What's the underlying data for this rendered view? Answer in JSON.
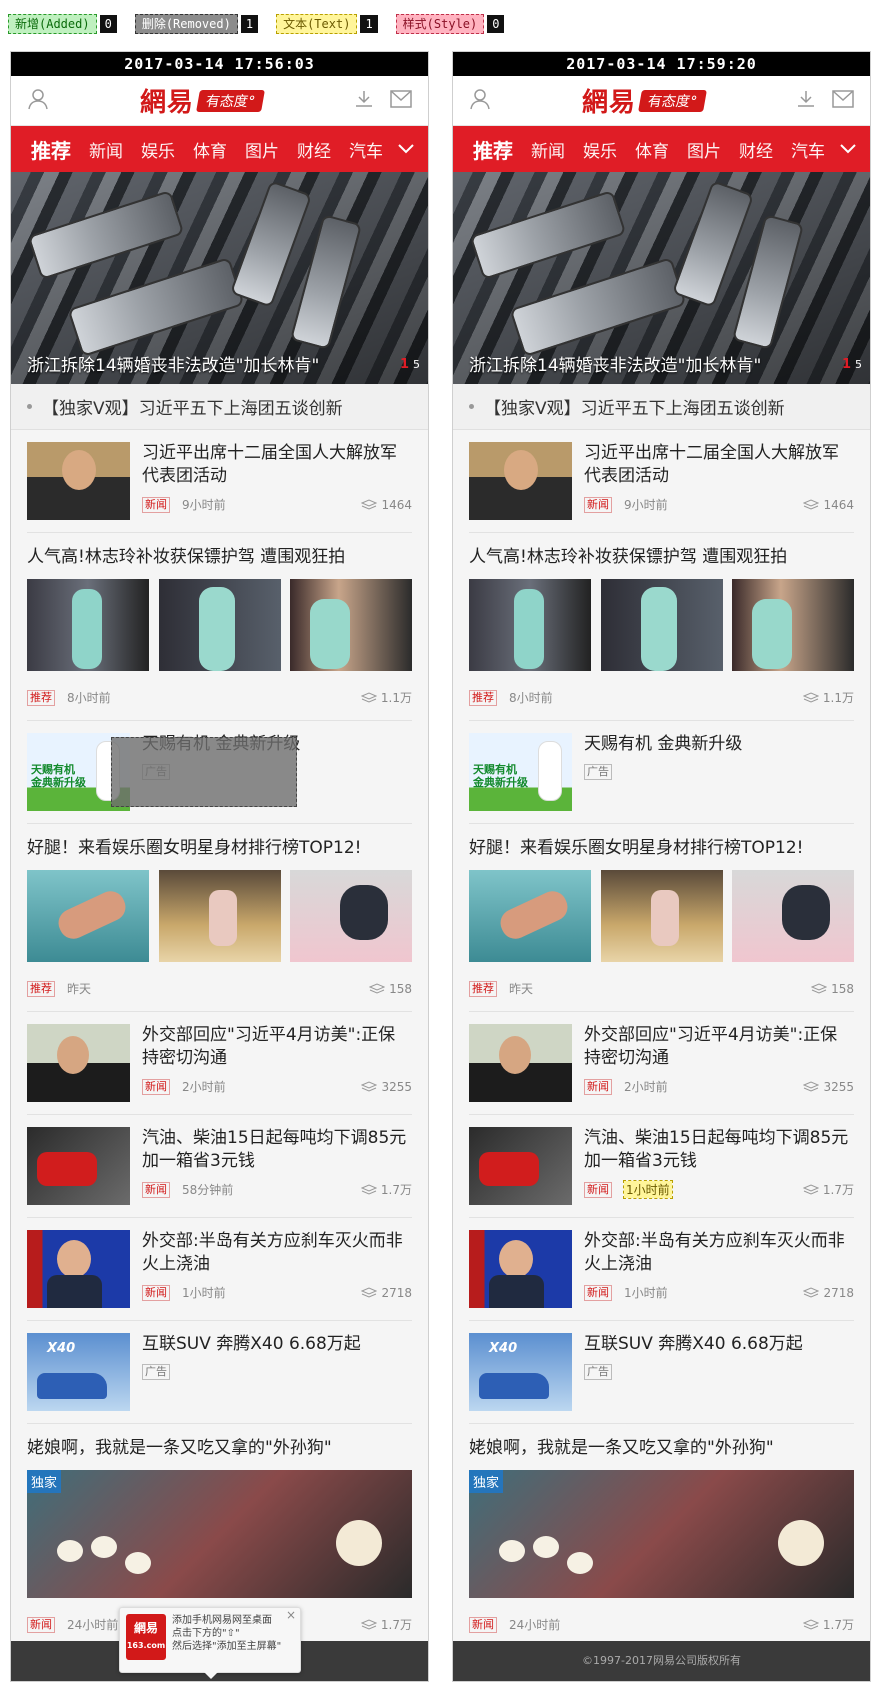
{
  "legend": [
    {
      "label": "新增(Added)",
      "count": "0",
      "kind": "added"
    },
    {
      "label": "删除(Removed)",
      "count": "1",
      "kind": "removed"
    },
    {
      "label": "文本(Text)",
      "count": "1",
      "kind": "text"
    },
    {
      "label": "样式(Style)",
      "count": "0",
      "kind": "style"
    }
  ],
  "brand": {
    "logo": "網易",
    "slogan": "有态度°",
    "accent": "#e01d26"
  },
  "nav": [
    "推荐",
    "新闻",
    "娱乐",
    "体育",
    "图片",
    "财经",
    "汽车"
  ],
  "hero": {
    "caption": "浙江拆除14辆婚丧非法改造\"加长林肯\"",
    "page_current": "1",
    "page_total": "5"
  },
  "ticker": "【独家V观】习近平五下上海团五谈创新",
  "left": {
    "timestamp": "2017-03-14  17:56:03",
    "items": {
      "i1": {
        "title": "习近平出席十二届全国人大解放军代表团活动",
        "chan": "新闻",
        "time": "9小时前",
        "count": "1464"
      },
      "i2": {
        "title": "人气高!林志玲补妆获保镖护驾  遭围观狂拍",
        "chan": "推荐",
        "time": "8小时前",
        "count": "1.1万"
      },
      "i3": {
        "title": "天赐有机  金典新升级",
        "chan": "广告"
      },
      "i4": {
        "title": "好腿！来看娱乐圈女明星身材排行榜TOP12!",
        "chan": "推荐",
        "time": "昨天",
        "count": "158"
      },
      "i5": {
        "title": "外交部回应\"习近平4月访美\":正保持密切沟通",
        "chan": "新闻",
        "time": "2小时前",
        "count": "3255"
      },
      "i6": {
        "title": "汽油、柴油15日起每吨均下调85元  加一箱省3元钱",
        "chan": "新闻",
        "time": "58分钟前",
        "count": "1.7万"
      },
      "i7": {
        "title": "外交部:半岛有关方应刹车灭火而非火上浇油",
        "chan": "新闻",
        "time": "1小时前",
        "count": "2718"
      },
      "i8": {
        "title": "互联SUV  奔腾X40  6.68万起",
        "chan": "广告"
      },
      "i9": {
        "title": "姥娘啊，我就是一条又吃又拿的\"外孙狗\"",
        "tag": "独家",
        "chan": "新闻",
        "time": "24小时前",
        "count": "1.7万"
      }
    },
    "popup": {
      "logo": "網易",
      "sub": "163.com",
      "line1": "添加手机网易网至桌面",
      "line2": "点击下方的\"⇧\"",
      "line3": "然后选择\"添加至主屏幕\"",
      "close": "×"
    }
  },
  "right": {
    "timestamp": "2017-03-14  17:59:20",
    "items": {
      "i1": {
        "title": "习近平出席十二届全国人大解放军代表团活动",
        "chan": "新闻",
        "time": "9小时前",
        "count": "1464"
      },
      "i2": {
        "title": "人气高!林志玲补妆获保镖护驾  遭围观狂拍",
        "chan": "推荐",
        "time": "8小时前",
        "count": "1.1万"
      },
      "i3": {
        "title": "天赐有机  金典新升级",
        "chan": "广告"
      },
      "i4": {
        "title": "好腿！来看娱乐圈女明星身材排行榜TOP12!",
        "chan": "推荐",
        "time": "昨天",
        "count": "158"
      },
      "i5": {
        "title": "外交部回应\"习近平4月访美\":正保持密切沟通",
        "chan": "新闻",
        "time": "2小时前",
        "count": "3255"
      },
      "i6": {
        "title": "汽油、柴油15日起每吨均下调85元  加一箱省3元钱",
        "chan": "新闻",
        "time": "1小时前",
        "count": "1.7万"
      },
      "i7": {
        "title": "外交部:半岛有关方应刹车灭火而非火上浇油",
        "chan": "新闻",
        "time": "1小时前",
        "count": "2718"
      },
      "i8": {
        "title": "互联SUV  奔腾X40  6.68万起",
        "chan": "广告"
      },
      "i9": {
        "title": "姥娘啊，我就是一条又吃又拿的\"外孙狗\"",
        "tag": "独家",
        "chan": "新闻",
        "time": "24小时前",
        "count": "1.7万"
      }
    },
    "footer": "©1997-2017网易公司版权所有"
  },
  "icons": {
    "user": "user-icon",
    "download": "download-icon",
    "mail": "mail-icon",
    "chevron": "chevron-down-icon",
    "stack": "stack-icon"
  }
}
